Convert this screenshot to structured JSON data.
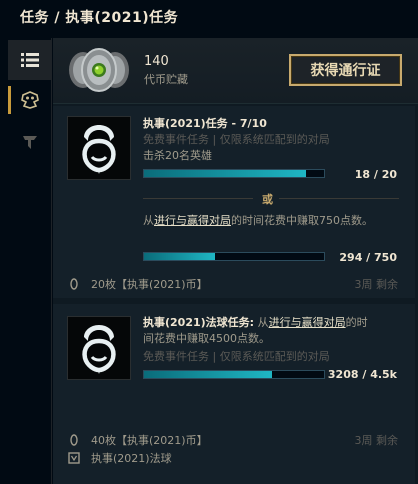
{
  "header": {
    "title": "任务 / 执事(2021)任务"
  },
  "sidebar": {
    "items": [
      {
        "icon": "list-icon"
      },
      {
        "icon": "sentinel-emblem-icon"
      },
      {
        "icon": "banner-emblem-icon"
      }
    ]
  },
  "currency": {
    "amount": "140",
    "label": "代币贮藏",
    "button_label": "获得通行证"
  },
  "missions": [
    {
      "title": "执事(2021)任务 - 7/10",
      "subtitle": "免费事件任务 | 仅限系统匹配到的对局",
      "objective1": "击杀20名英雄",
      "progress1_text": "18 / 20",
      "progress1_fraction": 0.9,
      "or_label": "或",
      "objective2_prefix": "从",
      "objective2_link1": "进行与",
      "objective2_link2": "赢得对局",
      "objective2_suffix": "的时间花费中赚取750点数。",
      "progress2_text": "294 / 750",
      "progress2_fraction": 0.392,
      "reward": "20枚【执事(2021)币】",
      "time_left": "3周 剩余"
    },
    {
      "title": "执事(2021)法球任务:",
      "desc_prefix": "从",
      "desc_link1": "进行与",
      "desc_link2": "赢得对局",
      "desc_mid": "的时",
      "desc_line2": "间花费中赚取4500点数。",
      "subtitle": "免费事件任务 | 仅限系统匹配到的对局",
      "progress_text": "3208 / 4.5k",
      "progress_fraction": 0.713,
      "reward1": "40枚【执事(2021)币】",
      "reward2": "执事(2021)法球",
      "time_left": "3周 剩余"
    }
  ]
}
